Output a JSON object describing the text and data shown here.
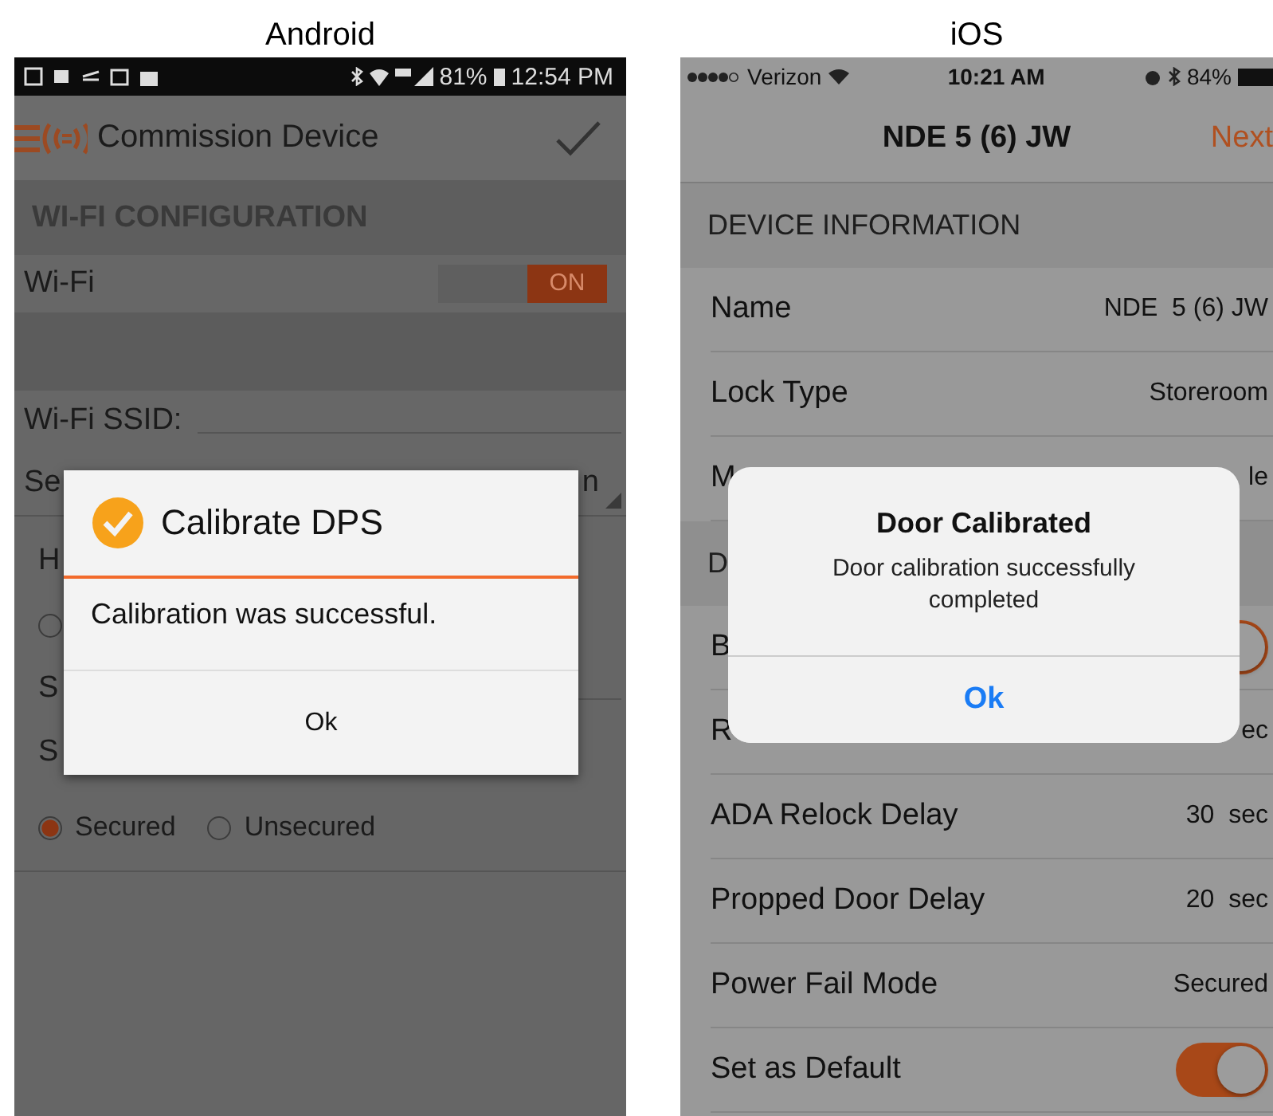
{
  "android": {
    "label": "Android",
    "status_bar": {
      "battery": "81%",
      "time": "12:54 PM"
    },
    "app_bar": {
      "title": "Commission Device"
    },
    "section": "WI-FI CONFIGURATION",
    "wifi": {
      "label": "Wi-Fi",
      "toggle": "ON",
      "on": true
    },
    "ssid": {
      "label": "Wi-Fi SSID:"
    },
    "security": {
      "label": "Se",
      "value": "n"
    },
    "rows": [
      {
        "kind": "label",
        "label": "H"
      },
      {
        "kind": "radio",
        "selected": false
      },
      {
        "kind": "field",
        "label": "S"
      },
      {
        "kind": "label",
        "label": "S"
      }
    ],
    "radios": [
      {
        "label": "Secured",
        "selected": true
      },
      {
        "label": "Unsecured",
        "selected": false
      }
    ],
    "dialog": {
      "title": "Calibrate DPS",
      "message": "Calibration was successful.",
      "button": "Ok"
    }
  },
  "ios": {
    "label": "iOS",
    "status_bar": {
      "carrier": "Verizon",
      "time": "10:21 AM",
      "battery": "84%"
    },
    "nav": {
      "title": "NDE  5 (6) JW",
      "action": "Next"
    },
    "sections": [
      {
        "header": "DEVICE INFORMATION",
        "rows": [
          {
            "kind": "value",
            "label": "Name",
            "value": "NDE  5 (6) JW"
          },
          {
            "kind": "value",
            "label": "Lock Type",
            "value": "Storeroom"
          },
          {
            "kind": "value",
            "label": "M",
            "value": "le"
          }
        ]
      },
      {
        "header": "D",
        "rows": [
          {
            "kind": "toggle",
            "label": "B",
            "on": true
          },
          {
            "kind": "value",
            "label": "R",
            "value": "ec"
          },
          {
            "kind": "value",
            "label": "ADA Relock Delay",
            "value": "30  sec"
          },
          {
            "kind": "value",
            "label": "Propped Door Delay",
            "value": "20  sec"
          },
          {
            "kind": "value",
            "label": "Power Fail Mode",
            "value": "Secured"
          },
          {
            "kind": "toggle",
            "label": "Set as Default",
            "on": true
          }
        ]
      }
    ],
    "dialog": {
      "title": "Door Calibrated",
      "message": "Door calibration successfully completed",
      "button": "Ok"
    }
  }
}
